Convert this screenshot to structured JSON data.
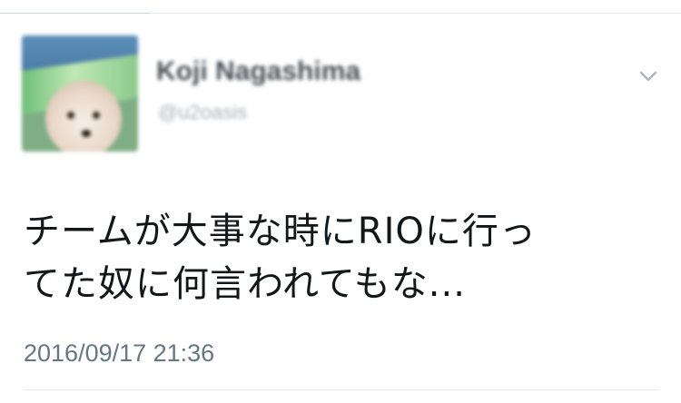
{
  "tweet": {
    "author": {
      "display_name": "Koji Nagashima",
      "handle": "@u2oasis",
      "avatar_icon": "profile-photo-dog"
    },
    "text_lines": [
      "チームが大事な時にRIOに行っ",
      "てた奴に何言われてもな..."
    ],
    "timestamp": "2016/09/17 21:36",
    "menu_icon": "chevron-down-icon"
  },
  "colors": {
    "text": "#14171a",
    "secondary": "#657786",
    "divider": "#e1e8ed",
    "caret": "#a9b7c3"
  }
}
